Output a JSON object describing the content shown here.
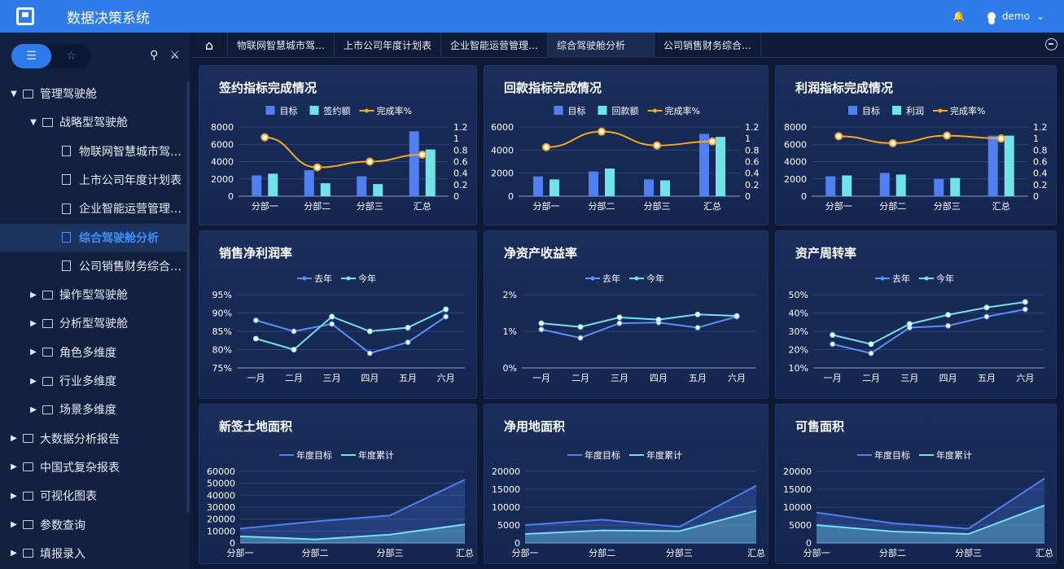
{
  "app": {
    "title": "数据决策系统",
    "user": "demo"
  },
  "sidebar": {
    "items": [
      {
        "label": "管理驾驶舱",
        "level": 0,
        "kind": "folder",
        "open": true
      },
      {
        "label": "战略型驾驶舱",
        "level": 1,
        "kind": "folder",
        "open": true
      },
      {
        "label": "物联网智慧城市驾…",
        "level": 2,
        "kind": "doc"
      },
      {
        "label": "上市公司年度计划表",
        "level": 2,
        "kind": "doc"
      },
      {
        "label": "企业智能运营管理…",
        "level": 2,
        "kind": "doc"
      },
      {
        "label": "综合驾驶舱分析",
        "level": 2,
        "kind": "doc",
        "active": true
      },
      {
        "label": "公司销售财务综合…",
        "level": 2,
        "kind": "doc"
      },
      {
        "label": "操作型驾驶舱",
        "level": 1,
        "kind": "folder"
      },
      {
        "label": "分析型驾驶舱",
        "level": 1,
        "kind": "folder"
      },
      {
        "label": "角色多维度",
        "level": 1,
        "kind": "folder"
      },
      {
        "label": "行业多维度",
        "level": 1,
        "kind": "folder"
      },
      {
        "label": "场景多维度",
        "level": 1,
        "kind": "folder"
      },
      {
        "label": "大数据分析报告",
        "level": 0,
        "kind": "folder"
      },
      {
        "label": "中国式复杂报表",
        "level": 0,
        "kind": "folder"
      },
      {
        "label": "可视化图表",
        "level": 0,
        "kind": "folder"
      },
      {
        "label": "参数查询",
        "level": 0,
        "kind": "folder"
      },
      {
        "label": "填报录入",
        "level": 0,
        "kind": "folder"
      }
    ]
  },
  "tabs": [
    {
      "label": "物联网智慧城市驾…",
      "active": false
    },
    {
      "label": "上市公司年度计划表",
      "active": false
    },
    {
      "label": "企业智能运营管理…",
      "active": false
    },
    {
      "label": "综合驾驶舱分析",
      "active": true
    },
    {
      "label": "公司销售财务综合…",
      "active": false
    }
  ],
  "colors": {
    "bar1": "#4f7ff0",
    "bar2": "#6fe3e8",
    "rate": "#f5a623",
    "lastYear": "#5b8ff9",
    "thisYear": "#75dff0",
    "areaTarget": "#4f7ff0",
    "areaCum": "#75dff0"
  },
  "chart_data": [
    {
      "type": "bar",
      "title": "签约指标完成情况",
      "categories": [
        "分部一",
        "分部二",
        "分部三",
        "汇总"
      ],
      "series": [
        {
          "name": "目标",
          "values": [
            2400,
            3000,
            2300,
            7500
          ]
        },
        {
          "name": "签约额",
          "values": [
            2600,
            1500,
            1400,
            5400
          ]
        }
      ],
      "line": {
        "name": "完成率%",
        "values": [
          1.02,
          0.5,
          0.6,
          0.72
        ]
      },
      "ylim": [
        0,
        8000
      ],
      "y2lim": [
        0,
        1.2
      ],
      "yticks": [
        "0",
        "2000",
        "4000",
        "6000",
        "8000"
      ],
      "y2ticks": [
        "0",
        "0.2",
        "0.4",
        "0.6",
        "0.8",
        "1",
        "1.2"
      ]
    },
    {
      "type": "bar",
      "title": "回款指标完成情况",
      "categories": [
        "分部一",
        "分部二",
        "分部三",
        "汇总"
      ],
      "series": [
        {
          "name": "目标",
          "values": [
            2000,
            2500,
            1700,
            6300
          ]
        },
        {
          "name": "回款额",
          "values": [
            1700,
            2800,
            1600,
            6000
          ]
        }
      ],
      "line": {
        "name": "完成率%",
        "values": [
          0.85,
          1.12,
          0.88,
          0.95
        ]
      },
      "ylim": [
        0,
        7000
      ],
      "y2lim": [
        0,
        1.2
      ],
      "yticks": [
        "0",
        "2000",
        "4000",
        "6000"
      ],
      "y2ticks": [
        "0",
        "0.2",
        "0.4",
        "0.6",
        "0.8",
        "1",
        "1.2"
      ]
    },
    {
      "type": "bar",
      "title": "利润指标完成情况",
      "categories": [
        "分部一",
        "分部二",
        "分部三",
        "汇总"
      ],
      "series": [
        {
          "name": "目标",
          "values": [
            2300,
            2700,
            2000,
            7000
          ]
        },
        {
          "name": "利润",
          "values": [
            2400,
            2500,
            2100,
            7000
          ]
        }
      ],
      "line": {
        "name": "完成率%",
        "values": [
          1.04,
          0.92,
          1.05,
          1.0
        ]
      },
      "ylim": [
        0,
        8000
      ],
      "y2lim": [
        0,
        1.2
      ],
      "yticks": [
        "0",
        "2000",
        "4000",
        "6000",
        "8000"
      ],
      "y2ticks": [
        "0",
        "0.2",
        "0.4",
        "0.6",
        "0.8",
        "1",
        "1.2"
      ]
    },
    {
      "type": "line",
      "title": "销售净利润率",
      "categories": [
        "一月",
        "二月",
        "三月",
        "四月",
        "五月",
        "六月"
      ],
      "series": [
        {
          "name": "去年",
          "values": [
            88,
            85,
            87,
            79,
            82,
            89
          ]
        },
        {
          "name": "今年",
          "values": [
            83,
            80,
            89,
            85,
            86,
            91
          ]
        }
      ],
      "ylim": [
        75,
        95
      ],
      "yticks": [
        "75%",
        "80%",
        "85%",
        "90%",
        "95%"
      ]
    },
    {
      "type": "line",
      "title": "净资产收益率",
      "categories": [
        "一月",
        "二月",
        "三月",
        "四月",
        "五月",
        "六月"
      ],
      "series": [
        {
          "name": "去年",
          "values": [
            1.05,
            0.82,
            1.22,
            1.24,
            1.1,
            1.4
          ]
        },
        {
          "name": "今年",
          "values": [
            1.22,
            1.12,
            1.38,
            1.32,
            1.46,
            1.42
          ]
        }
      ],
      "ylim": [
        0,
        2
      ],
      "yticks": [
        "0%",
        "1%",
        "2%"
      ]
    },
    {
      "type": "line",
      "title": "资产周转率",
      "categories": [
        "一月",
        "二月",
        "三月",
        "四月",
        "五月",
        "六月"
      ],
      "series": [
        {
          "name": "去年",
          "values": [
            23,
            18,
            32,
            33,
            38,
            42
          ]
        },
        {
          "name": "今年",
          "values": [
            28,
            23,
            34,
            39,
            43,
            46
          ]
        }
      ],
      "ylim": [
        10,
        50
      ],
      "yticks": [
        "10%",
        "20%",
        "30%",
        "40%",
        "50%"
      ]
    },
    {
      "type": "area",
      "title": "新签土地面积",
      "categories": [
        "分部一",
        "分部二",
        "分部三",
        "汇总"
      ],
      "series": [
        {
          "name": "年度目标",
          "values": [
            12000,
            18000,
            23000,
            53000
          ]
        },
        {
          "name": "年度累计",
          "values": [
            5500,
            3000,
            7000,
            15500
          ]
        }
      ],
      "ylim": [
        0,
        60000
      ],
      "yticks": [
        "0",
        "10000",
        "20000",
        "30000",
        "40000",
        "50000",
        "60000"
      ]
    },
    {
      "type": "area",
      "title": "净用地面积",
      "categories": [
        "分部一",
        "分部二",
        "分部三",
        "汇总"
      ],
      "series": [
        {
          "name": "年度目标",
          "values": [
            5000,
            6500,
            4500,
            16000
          ]
        },
        {
          "name": "年度累计",
          "values": [
            2500,
            3500,
            3300,
            9000
          ]
        }
      ],
      "ylim": [
        0,
        20000
      ],
      "yticks": [
        "0",
        "5000",
        "10000",
        "15000",
        "20000"
      ]
    },
    {
      "type": "area",
      "title": "可售面积",
      "categories": [
        "分部一",
        "分部二",
        "分部三",
        "汇总"
      ],
      "series": [
        {
          "name": "年度目标",
          "values": [
            8500,
            5500,
            4000,
            18000
          ]
        },
        {
          "name": "年度累计",
          "values": [
            5000,
            3200,
            2500,
            10500
          ]
        }
      ],
      "ylim": [
        0,
        20000
      ],
      "yticks": [
        "0",
        "5000",
        "10000",
        "15000",
        "20000"
      ]
    }
  ]
}
